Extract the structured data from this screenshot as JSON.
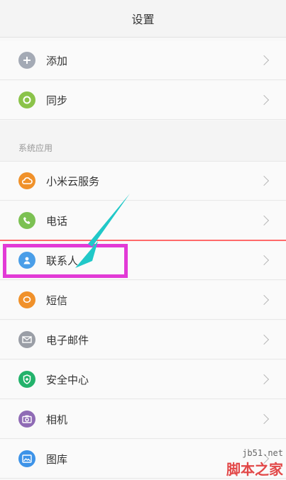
{
  "header": {
    "title": "设置"
  },
  "rows_top": [
    {
      "label": "添加",
      "icon": "plus-icon",
      "color": "#a4aab5"
    },
    {
      "label": "同步",
      "icon": "sync-icon",
      "color": "#8bc34a"
    }
  ],
  "section": {
    "title": "系统应用"
  },
  "rows": [
    {
      "label": "小米云服务",
      "icon": "cloud-icon",
      "color": "#f0912a"
    },
    {
      "label": "电话",
      "icon": "phone-icon",
      "color": "#7cc153"
    },
    {
      "label": "联系人",
      "icon": "contact-icon",
      "color": "#4a9ee8"
    },
    {
      "label": "短信",
      "icon": "message-icon",
      "color": "#f0912a"
    },
    {
      "label": "电子邮件",
      "icon": "mail-icon",
      "color": "#9a9ea6"
    },
    {
      "label": "安全中心",
      "icon": "shield-icon",
      "color": "#23b26b"
    },
    {
      "label": "相机",
      "icon": "camera-icon",
      "color": "#8f6bb5"
    },
    {
      "label": "图库",
      "icon": "gallery-icon",
      "color": "#3d93e8"
    }
  ],
  "watermark": {
    "site": "jb51.net",
    "name": "脚本之家"
  },
  "colors": {
    "highlight": "#e23ad6",
    "arrow": "#20c8c8",
    "red_line": "#ff6a6a"
  }
}
